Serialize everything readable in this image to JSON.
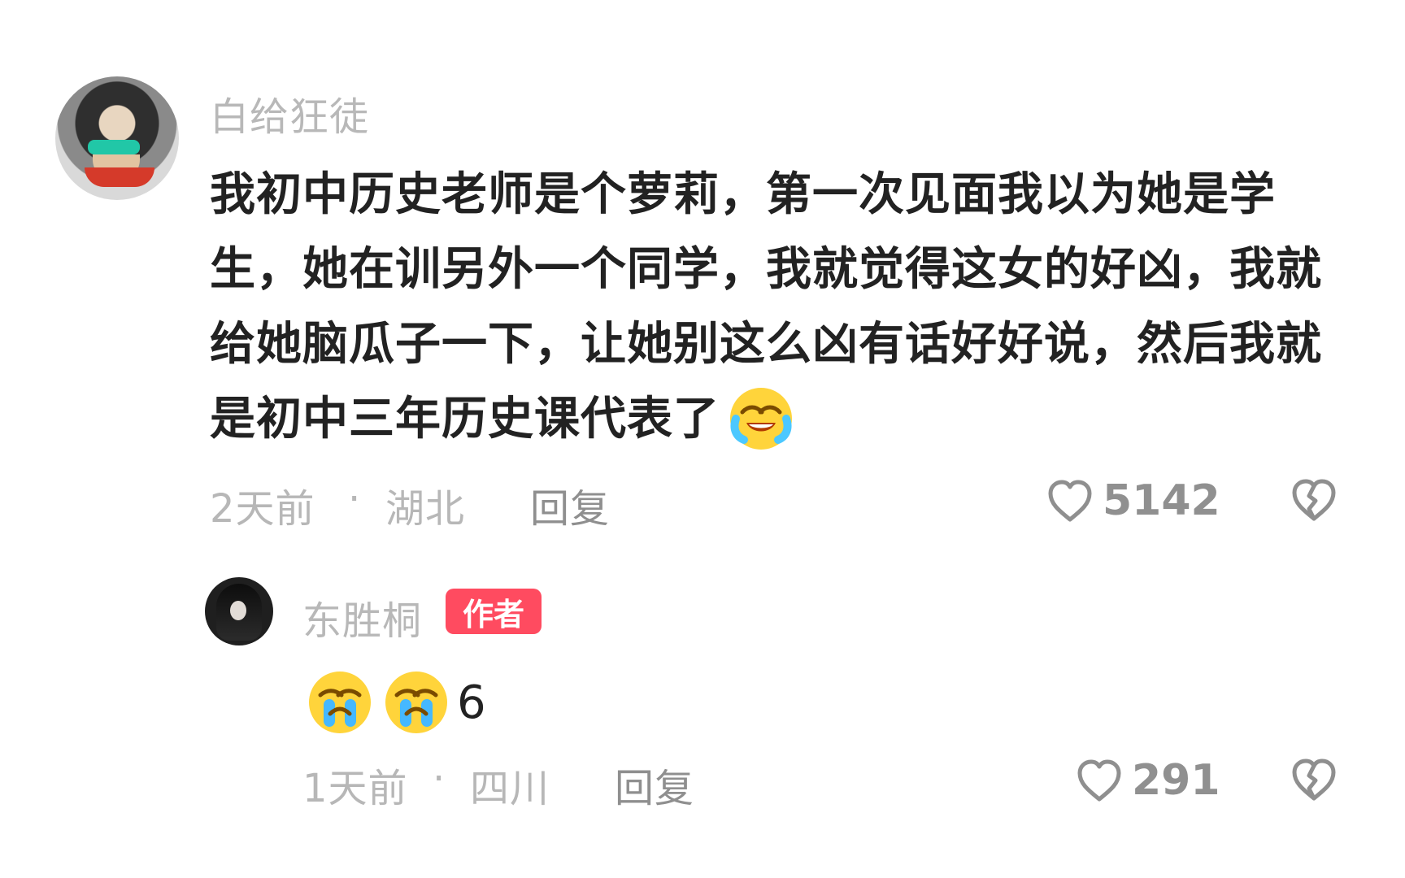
{
  "main_comment": {
    "username": "白给狂徒",
    "text": "我初中历史老师是个萝莉，第一次见面我以为她是学生，她在训另外一个同学，我就觉得这女的好凶，我就给她脑瓜子一下，让她别这么凶有话好好说，然后我就是初中三年历史课代表了",
    "time": "2天前",
    "location": "湖北",
    "reply_label": "回复",
    "like_count": "5142"
  },
  "reply_comment": {
    "username": "东胜桐",
    "author_tag": "作者",
    "text": "6",
    "time": "1天前",
    "location": "四川",
    "reply_label": "回复",
    "like_count": "291"
  },
  "separator": "·",
  "icons": {
    "main_avatar": "avatar-icon",
    "reply_avatar": "avatar-icon",
    "heart": "heart-icon",
    "broken_heart": "broken-heart-icon",
    "laugh_cry": "laugh-cry-emoji-icon",
    "cry": "cry-emoji-icon"
  },
  "colors": {
    "author_tag": "#ff4b60",
    "text_main": "#222222",
    "text_meta": "#b7b7b7"
  }
}
